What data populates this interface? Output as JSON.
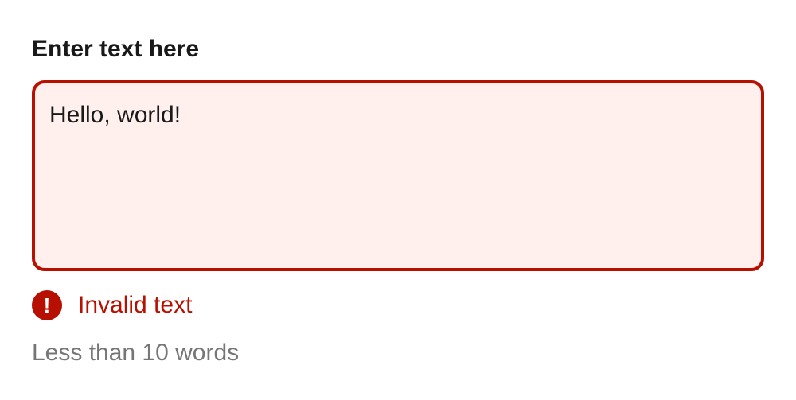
{
  "field": {
    "label": "Enter text here",
    "value": "Hello, world!",
    "placeholder": ""
  },
  "error": {
    "icon": "error-exclamation-icon",
    "icon_glyph": "!",
    "message": "Invalid text"
  },
  "hint": {
    "text": "Less than 10 words"
  },
  "colors": {
    "error": "#b71000",
    "error_background": "#fff0ee",
    "label": "#191919",
    "hint": "#767676"
  }
}
